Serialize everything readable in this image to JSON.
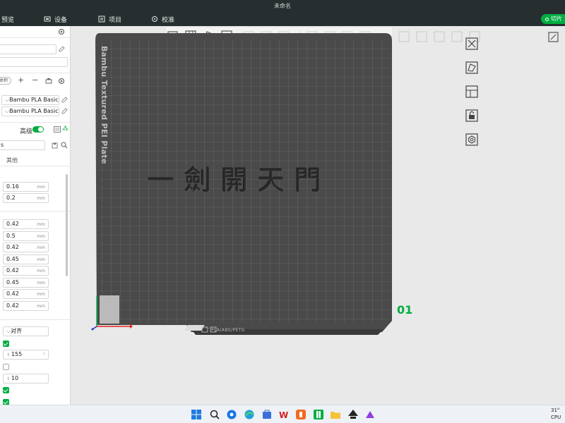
{
  "window": {
    "title": "未命名"
  },
  "menubar": {
    "preview": "预览",
    "device": "设备",
    "project": "项目",
    "calibrate": "校准",
    "slice_button": "切片"
  },
  "sidebar": {
    "filament_tag": "体积",
    "filaments": [
      "Bambu PLA Basic",
      "Bambu PLA Basic"
    ],
    "advanced_label": "高级",
    "search_prefix": "s",
    "other_tab": "其他",
    "layer_values": [
      "0.16",
      "0.2"
    ],
    "line_width_values": [
      "0.42",
      "0.5",
      "0.42",
      "0.45",
      "0.42",
      "0.45",
      "0.42",
      "0.42"
    ],
    "unit": "mm",
    "align_label": "对齐",
    "value_155": "155",
    "value_10": "10"
  },
  "viewport": {
    "plate_label": "Bambu Textured PEI Plate",
    "model_text": "一劍開天門",
    "plate_number": "01",
    "plate_bar_text": "PLA/ABS/PETG"
  },
  "taskbar": {
    "clock_top": "31°",
    "clock_bottom": "CPU"
  },
  "colors": {
    "accent": "#00ae42",
    "topbar": "#262e30",
    "plate": "#4a4a4a"
  }
}
